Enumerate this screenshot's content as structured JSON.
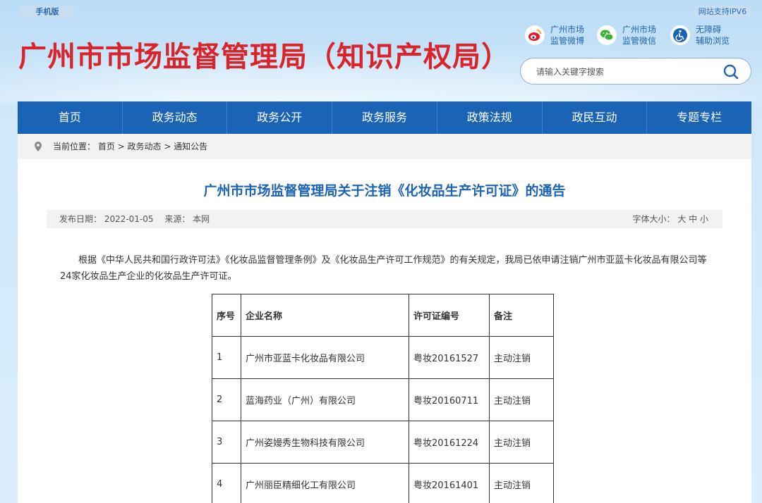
{
  "header": {
    "mobile_label": "手机版",
    "ipv6_label": "网站支持IPV6",
    "site_title": "广州市市场监督管理局（知识产权局）",
    "links": [
      {
        "label": "广州市场\n监管微博",
        "icon": "weibo-icon"
      },
      {
        "label": "广州市场\n监管微信",
        "icon": "wechat-icon"
      },
      {
        "label": "无障碍\n辅助浏览",
        "icon": "accessibility-icon"
      }
    ],
    "search_placeholder": "请输入关键字搜索"
  },
  "nav": [
    "首页",
    "政务动态",
    "政务公开",
    "政务服务",
    "政策法规",
    "政民互动",
    "专题专栏"
  ],
  "breadcrumb": "当前位置： 首页 > 政务动态 > 通知公告",
  "article": {
    "title": "广州市市场监督管理局关于注销《化妆品生产许可证》的通告",
    "meta_left": "发布日期： 2022-01-05　 来源： 本网",
    "meta_right": "字体大小： 大  中  小",
    "body": "根据《中华人民共和国行政许可法》《化妆品监督管理条例》及《化妆品生产许可工作规范》的有关规定，我局已依申请注销广州市亚蓝卡化妆品有限公司等24家化妆品生产企业的化妆品生产许可证。"
  },
  "table": {
    "headers": [
      "序号",
      "企业名称",
      "许可证编号",
      "备注"
    ],
    "rows": [
      [
        "1",
        "广州市亚蓝卡化妆品有限公司",
        "粤妆20161527",
        "主动注销"
      ],
      [
        "2",
        "蓝海药业（广州）有限公司",
        "粤妆20160711",
        "主动注销"
      ],
      [
        "3",
        "广州姿嫚秀生物科技有限公司",
        "粤妆20161224",
        "主动注销"
      ],
      [
        "4",
        "广州丽臣精细化工有限公司",
        "粤妆20161401",
        "主动注销"
      ]
    ]
  },
  "colors": {
    "brand_red": "#d9252a",
    "nav_blue": "#1b63b5"
  }
}
